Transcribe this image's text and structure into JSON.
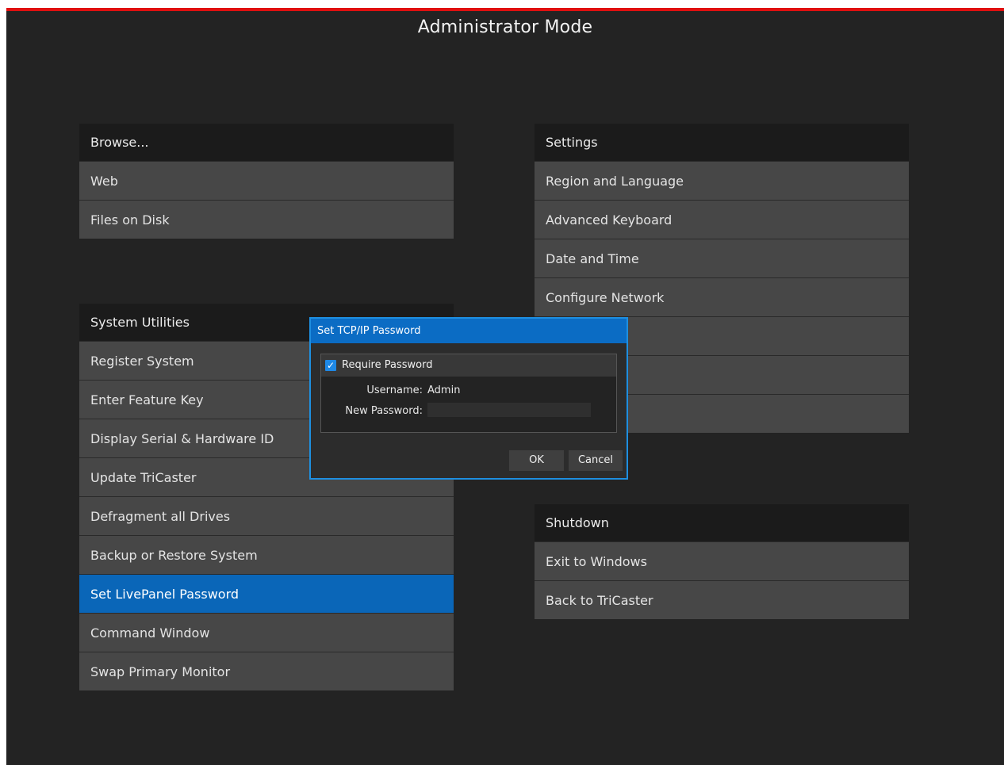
{
  "header": {
    "title": "Administrator Mode"
  },
  "browse": {
    "title": "Browse...",
    "items": [
      {
        "label": "Web"
      },
      {
        "label": "Files on Disk"
      }
    ]
  },
  "settings": {
    "title": "Settings",
    "items": [
      {
        "label": "Region and Language"
      },
      {
        "label": "Advanced Keyboard"
      },
      {
        "label": "Date and Time"
      },
      {
        "label": "Configure Network"
      },
      {
        "label": ""
      },
      {
        "label": ""
      },
      {
        "label": ""
      }
    ]
  },
  "utilities": {
    "title": "System Utilities",
    "items": [
      {
        "label": "Register System"
      },
      {
        "label": "Enter Feature Key"
      },
      {
        "label": "Display Serial & Hardware ID"
      },
      {
        "label": "Update TriCaster"
      },
      {
        "label": "Defragment all Drives"
      },
      {
        "label": "Backup or Restore System"
      },
      {
        "label": "Set LivePanel Password",
        "selected": true
      },
      {
        "label": "Command Window"
      },
      {
        "label": "Swap Primary Monitor"
      }
    ]
  },
  "shutdown": {
    "title": "Shutdown",
    "items": [
      {
        "label": "Exit to Windows"
      },
      {
        "label": "Back to TriCaster"
      }
    ]
  },
  "dialog": {
    "title": "Set TCP/IP Password",
    "require_password_label": "Require Password",
    "require_password_checked": true,
    "check_glyph": "✓",
    "username_label": "Username:",
    "username_value": "Admin",
    "new_password_label": "New Password:",
    "new_password_value": "",
    "ok_label": "OK",
    "cancel_label": "Cancel"
  },
  "colors": {
    "accent_top_bar": "#e01010",
    "selection": "#0a66b8",
    "dialog_title": "#0b6cc4"
  }
}
